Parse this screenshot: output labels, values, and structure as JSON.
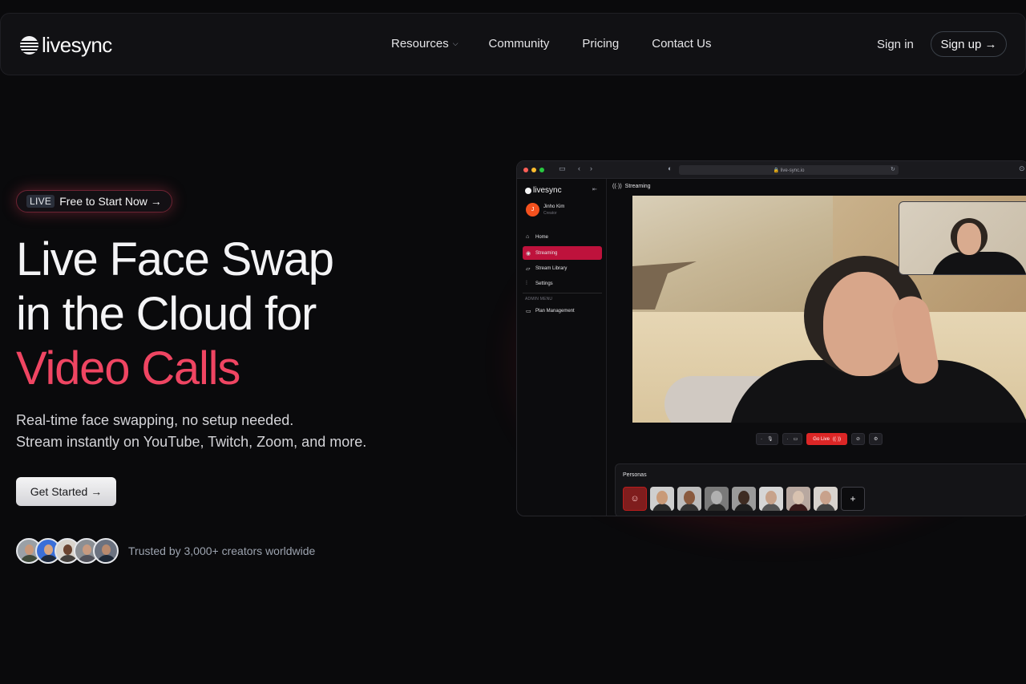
{
  "nav": {
    "logo": "livesync",
    "links": [
      "Resources",
      "Community",
      "Pricing",
      "Contact Us"
    ],
    "signin": "Sign in",
    "signup": "Sign up →"
  },
  "hero": {
    "badge_tag": "LIVE",
    "badge_text": "Free to Start Now →",
    "headline_line1": "Live Face Swap",
    "headline_line2": "in the Cloud for",
    "headline_accent": "Video Calls",
    "sub_line1": "Real-time face swapping, no setup needed.",
    "sub_line2": "Stream instantly on YouTube, Twitch, Zoom, and more.",
    "cta": "Get Started →",
    "trusted": "Trusted by 3,000+ creators worldwide"
  },
  "colors": {
    "accent": "#ef4562",
    "background": "#0a0a0c",
    "sidebar_active": "#be123c",
    "go_live": "#dc2626"
  },
  "app": {
    "url": "🔒 live-sync.io",
    "sidebar": {
      "logo": "livesync",
      "user_initial": "J",
      "user_name": "Jinho Kim",
      "user_role": "Creator",
      "items": [
        {
          "label": "Home",
          "icon": "home-icon"
        },
        {
          "label": "Streaming",
          "icon": "broadcast-icon"
        },
        {
          "label": "Stream Library",
          "icon": "folder-icon"
        },
        {
          "label": "Settings",
          "icon": "sliders-icon"
        }
      ],
      "admin_label": "ADMIN MENU",
      "admin_items": [
        {
          "label": "Plan Management",
          "icon": "card-icon"
        }
      ]
    },
    "main_title": "Streaming",
    "go_live": "Go Live",
    "personas_title": "Personas",
    "personas_add": "+"
  }
}
